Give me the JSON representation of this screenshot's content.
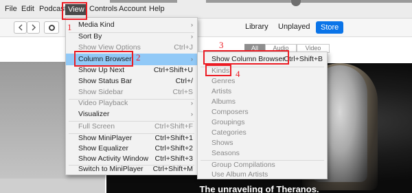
{
  "menubar": {
    "items": [
      "File",
      "Edit",
      "Podcast",
      "View",
      "Controls",
      "Account",
      "Help"
    ]
  },
  "toolbar": {
    "tabs": [
      "Library",
      "Unplayed",
      "Store"
    ]
  },
  "segments": [
    "All",
    "Audio",
    "Video"
  ],
  "view_menu": {
    "items": [
      {
        "label": "Media Kind",
        "shortcut": "",
        "submenu": true,
        "disabled": false
      },
      {
        "label": "Sort By",
        "shortcut": "",
        "submenu": true,
        "disabled": false
      },
      {
        "label": "Show View Options",
        "shortcut": "Ctrl+J",
        "submenu": false,
        "disabled": true
      },
      {
        "label": "Column Browser",
        "shortcut": "",
        "submenu": true,
        "disabled": false,
        "highlighted": true
      },
      {
        "label": "Show Up Next",
        "shortcut": "Ctrl+Shift+U",
        "submenu": false,
        "disabled": false
      },
      {
        "label": "Show Status Bar",
        "shortcut": "Ctrl+/",
        "submenu": false,
        "disabled": false
      },
      {
        "label": "Show Sidebar",
        "shortcut": "Ctrl+S",
        "submenu": false,
        "disabled": true
      },
      {
        "label": "Video Playback",
        "shortcut": "",
        "submenu": true,
        "disabled": true
      },
      {
        "label": "Visualizer",
        "shortcut": "",
        "submenu": true,
        "disabled": false
      },
      {
        "label": "Full Screen",
        "shortcut": "Ctrl+Shift+F",
        "submenu": false,
        "disabled": true
      },
      {
        "label": "Show MiniPlayer",
        "shortcut": "Ctrl+Shift+1",
        "submenu": false,
        "disabled": false
      },
      {
        "label": "Show Equalizer",
        "shortcut": "Ctrl+Shift+2",
        "submenu": false,
        "disabled": false
      },
      {
        "label": "Show Activity Window",
        "shortcut": "Ctrl+Shift+3",
        "submenu": false,
        "disabled": false
      },
      {
        "label": "Switch to MiniPlayer",
        "shortcut": "Ctrl+Shift+M",
        "submenu": false,
        "disabled": false
      }
    ]
  },
  "column_browser_menu": {
    "items": [
      {
        "label": "Show Column Browser",
        "shortcut": "Ctrl+Shift+B",
        "disabled": false
      },
      {
        "label": "Kinds",
        "shortcut": "",
        "disabled": true
      },
      {
        "label": "Genres",
        "shortcut": "",
        "disabled": true
      },
      {
        "label": "Artists",
        "shortcut": "",
        "disabled": true
      },
      {
        "label": "Albums",
        "shortcut": "",
        "disabled": true
      },
      {
        "label": "Composers",
        "shortcut": "",
        "disabled": true
      },
      {
        "label": "Groupings",
        "shortcut": "",
        "disabled": true
      },
      {
        "label": "Categories",
        "shortcut": "",
        "disabled": true
      },
      {
        "label": "Shows",
        "shortcut": "",
        "disabled": true
      },
      {
        "label": "Seasons",
        "shortcut": "",
        "disabled": true
      },
      {
        "label": "Group Compilations",
        "shortcut": "",
        "disabled": true
      },
      {
        "label": "Use Album Artists",
        "shortcut": "",
        "disabled": true
      }
    ]
  },
  "annotations": [
    "1",
    "2",
    "3",
    "4"
  ],
  "caption": "The unraveling of Theranos.",
  "colors": {
    "annotation_red": "#ec1c24",
    "store_blue": "#0a74e8",
    "menu_highlight": "#91c9f7"
  }
}
